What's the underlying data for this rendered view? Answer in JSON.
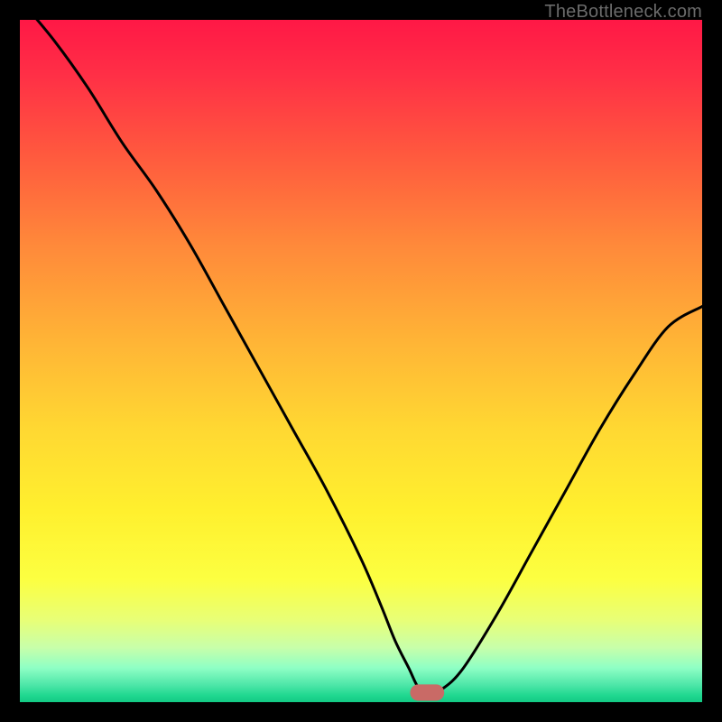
{
  "watermark": "TheBottleneck.com",
  "colors": {
    "background": "#000000",
    "curve": "#000000",
    "marker_fill": "#c96a66",
    "marker_stroke": "#8b3e3a",
    "watermark": "#6b6b6b"
  },
  "chart_data": {
    "type": "line",
    "title": "",
    "xlabel": "",
    "ylabel": "",
    "xlim": [
      0,
      100
    ],
    "ylim": [
      0,
      100
    ],
    "grid": false,
    "legend": false,
    "series": [
      {
        "name": "bottleneck-curve",
        "x": [
          0,
          5,
          10,
          15,
          20,
          25,
          30,
          35,
          40,
          45,
          50,
          53,
          55,
          57,
          58.5,
          60,
          62,
          65,
          70,
          75,
          80,
          85,
          90,
          95,
          100
        ],
        "values": [
          103,
          97,
          90,
          82,
          75,
          67,
          58,
          49,
          40,
          31,
          21,
          14,
          9,
          5,
          2,
          1.5,
          2.0,
          5,
          13,
          22,
          31,
          40,
          48,
          55,
          58
        ]
      }
    ],
    "marker": {
      "x_start": 57.2,
      "x_end": 62.2,
      "y": 1.4,
      "height": 2.4
    }
  }
}
